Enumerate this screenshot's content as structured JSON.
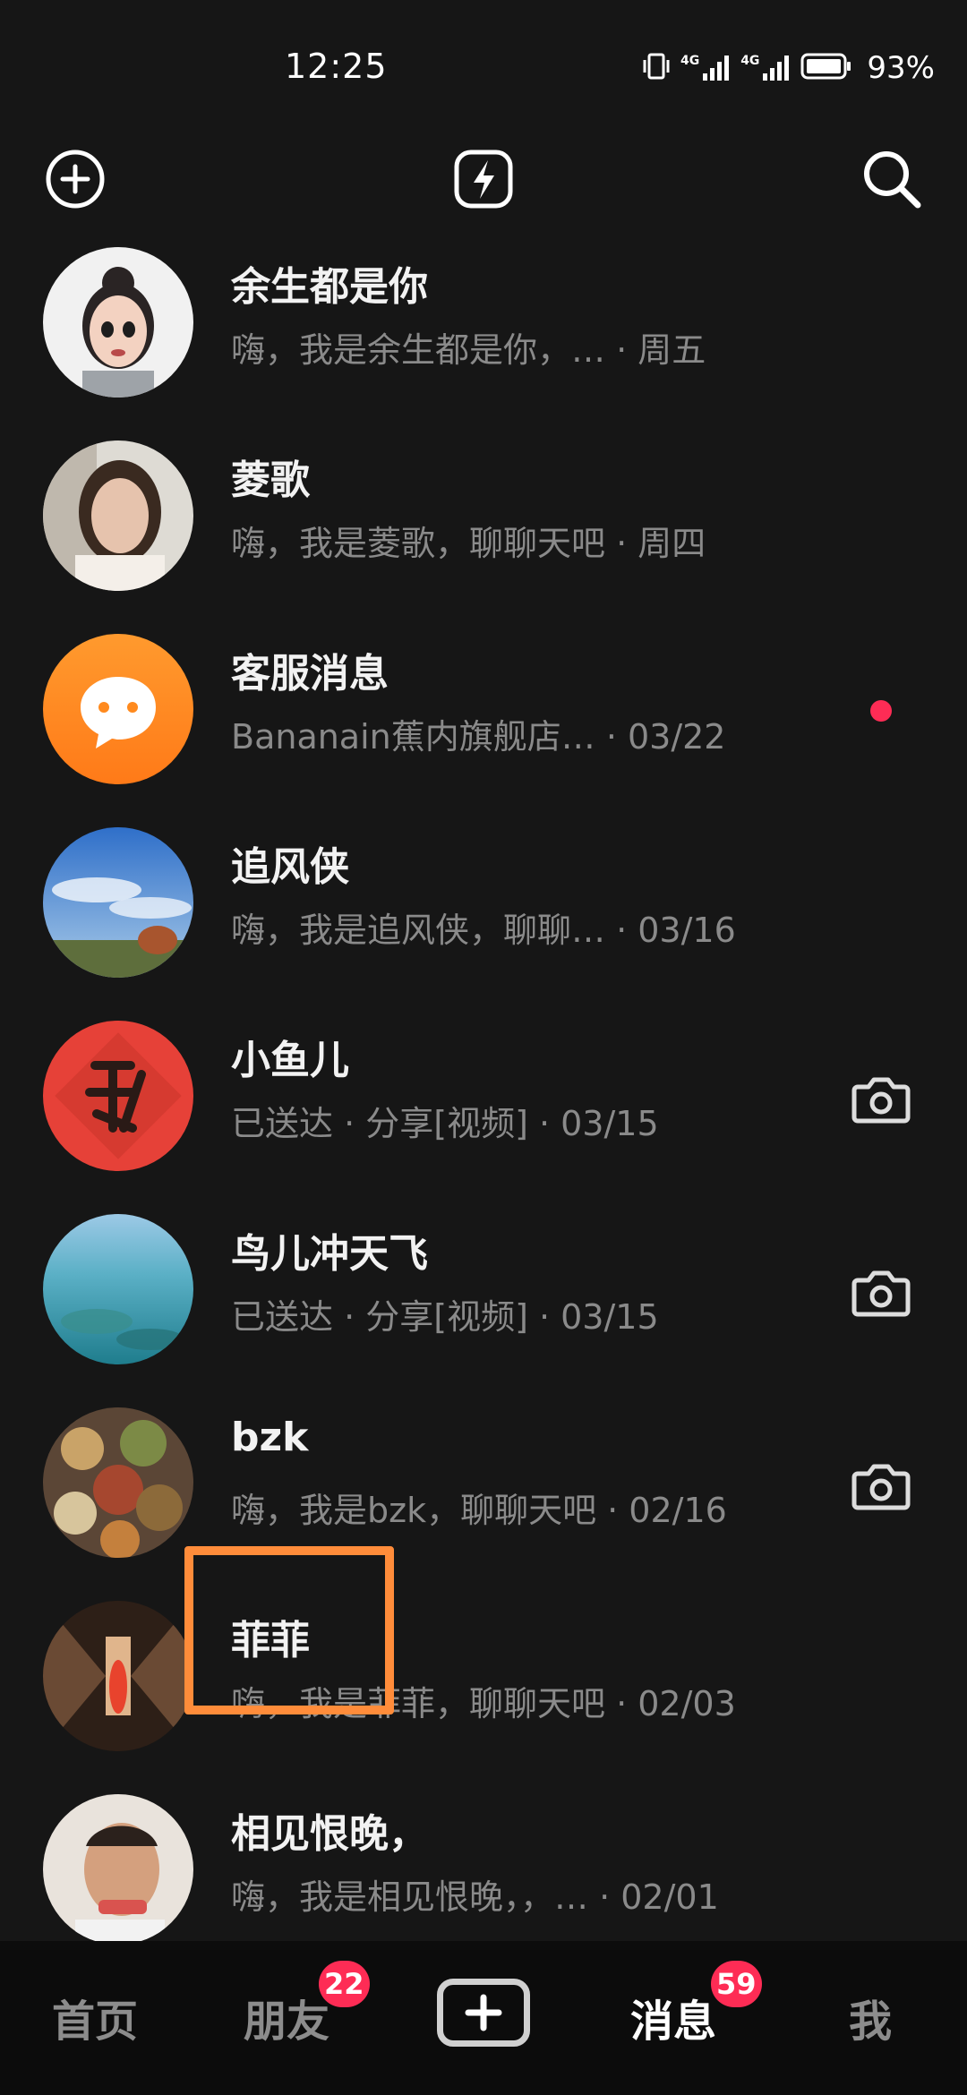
{
  "status_bar": {
    "time": "12:25",
    "network_1": "4G",
    "network_2": "4G",
    "battery_percent": "93%"
  },
  "top_bar": {
    "icons": [
      "add-circle-icon",
      "flash-icon",
      "search-icon"
    ]
  },
  "conversations": [
    {
      "name": "余生都是你",
      "preview": "嗨，我是余生都是你，…",
      "time": "周五",
      "meta": "嗨，我是余生都是你，…   · 周五",
      "trailing": "none"
    },
    {
      "name": "菱歌",
      "preview": "嗨，我是菱歌，聊聊天吧",
      "time": "周四",
      "meta": "嗨，我是菱歌，聊聊天吧 · 周四",
      "trailing": "none"
    },
    {
      "name": "客服消息",
      "preview": "Bananain蕉内旗舰店…",
      "time": "03/22",
      "meta": "Bananain蕉内旗舰店…  · 03/22",
      "trailing": "unread-dot"
    },
    {
      "name": "追风侠",
      "preview": "嗨，我是追风侠，聊聊…",
      "time": "03/16",
      "meta": "嗨，我是追风侠，聊聊… · 03/16",
      "trailing": "none"
    },
    {
      "name": "小鱼儿",
      "preview": "已送达 · 分享[视频]",
      "time": "03/15",
      "meta": "已送达 · 分享[视频] · 03/15",
      "trailing": "camera-icon"
    },
    {
      "name": "鸟儿冲天飞",
      "preview": "已送达 · 分享[视频]",
      "time": "03/15",
      "meta": "已送达 · 分享[视频] · 03/15",
      "trailing": "camera-icon"
    },
    {
      "name": "bzk",
      "preview": "嗨，我是bzk，聊聊天吧",
      "time": "02/16",
      "meta": "嗨，我是bzk，聊聊天吧 · 02/16",
      "trailing": "camera-icon"
    },
    {
      "name": "菲菲",
      "preview": "嗨，我是菲菲，聊聊天吧",
      "time": "02/03",
      "meta": "嗨，我是菲菲，聊聊天吧 · 02/03",
      "trailing": "none"
    },
    {
      "name": "相见恨晚，",
      "preview": "嗨，我是相见恨晚，，…",
      "time": "02/01",
      "meta": "嗨，我是相见恨晚，，… · 02/01",
      "trailing": "none"
    }
  ],
  "bottom_nav": {
    "home": "首页",
    "friends": "朋友",
    "friends_badge": "22",
    "messages": "消息",
    "messages_badge": "59",
    "me": "我",
    "active": "消息"
  },
  "colors": {
    "background": "#161616",
    "badge": "#fe2c55",
    "highlight": "#ff8c3a",
    "service_avatar": "#ff8a1e"
  }
}
